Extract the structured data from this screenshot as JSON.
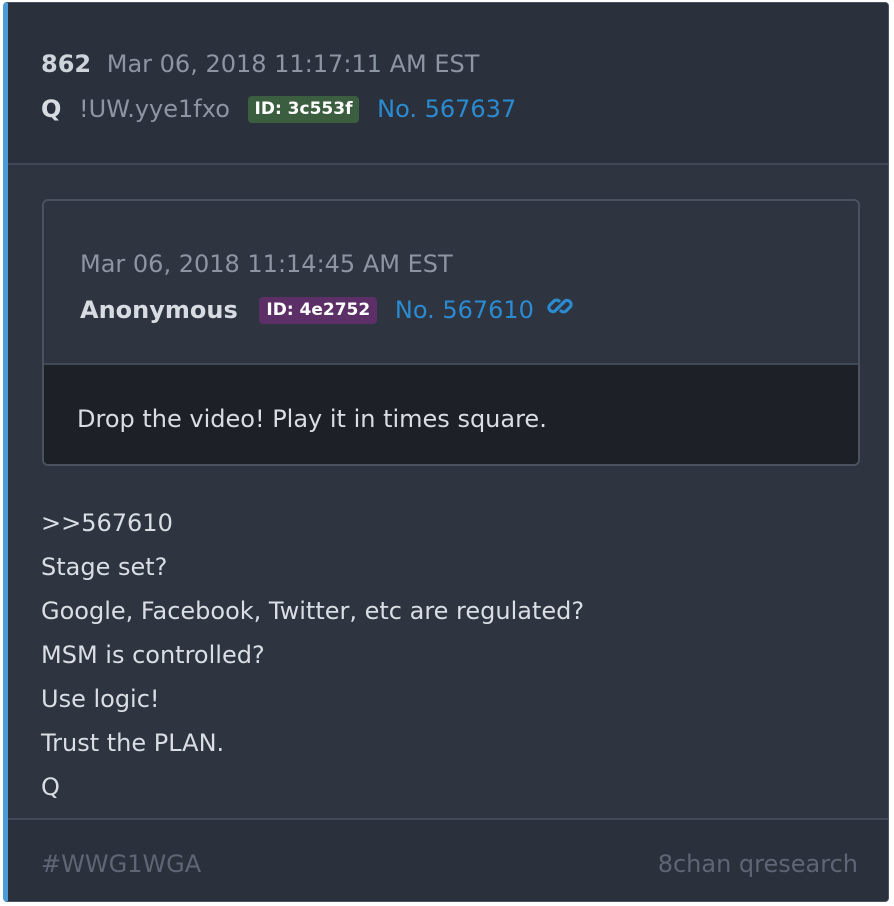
{
  "post": {
    "number": "862",
    "timestamp": "Mar 06, 2018 11:17:11 AM EST",
    "author": "Q",
    "tripcode": "!UW.yye1fxo",
    "id_badge": "ID: 3c553f",
    "post_no": "No. 567637",
    "id_badge_color": "#3b5e40"
  },
  "quote": {
    "timestamp": "Mar 06, 2018 11:14:45 AM EST",
    "author": "Anonymous",
    "id_badge": "ID: 4e2752",
    "post_no": "No. 567610",
    "link_icon": "link-icon",
    "body": "Drop the video! Play it in times square.",
    "id_badge_color": "#5c2f66"
  },
  "body_lines": [
    ">>567610",
    "Stage set?",
    "Google, Facebook, Twitter, etc are regulated?",
    "MSM is controlled?",
    "Use logic!",
    "Trust the PLAN.",
    "Q"
  ],
  "footer": {
    "hashtag": "#WWG1WGA",
    "source": "8chan qresearch"
  },
  "colors": {
    "accent": "#4b9bd8",
    "link": "#2b8bd1",
    "background": "#2e3440"
  }
}
